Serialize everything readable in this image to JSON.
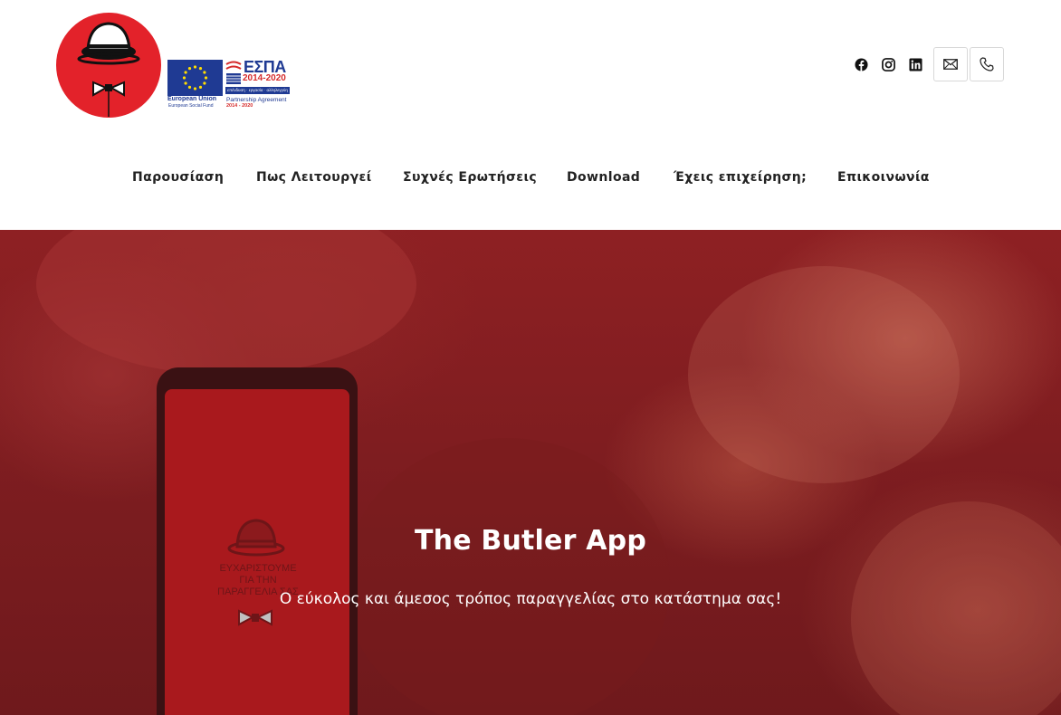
{
  "header": {
    "logo": {
      "icon": "butler-bowler-hat-logo",
      "accent": "#e3222a"
    },
    "sponsors": {
      "eu": {
        "icon": "eu-flag-icon",
        "line1": "European Union",
        "line2": "European Social Fund"
      },
      "espa": {
        "title": "ΕΣΠΑ",
        "years": "2014-2020",
        "bar": "επένδυση · εργασία · αλληλεγγύη",
        "line1": "Partnership Agreement",
        "line2": "2014 - 2020"
      }
    },
    "social": [
      {
        "name": "facebook",
        "icon": "facebook-icon"
      },
      {
        "name": "instagram",
        "icon": "instagram-icon"
      },
      {
        "name": "linkedin",
        "icon": "linkedin-icon"
      }
    ],
    "contact_buttons": [
      {
        "name": "email",
        "icon": "envelope-icon"
      },
      {
        "name": "phone",
        "icon": "phone-icon"
      }
    ]
  },
  "nav": {
    "items": [
      "Παρουσίαση",
      "Πως Λειτουργεί",
      "Συχνές Ερωτήσεις",
      "Download",
      "Έχεις επιχείρηση;",
      "Επικοινωνία"
    ]
  },
  "hero": {
    "title": "The Butler App",
    "subtitle": "Ο εύκολος και άμεσος τρόπος παραγγελίας στο κατάστημα σας!",
    "phone_screen_text": "ΕΥΧΑΡΙΣΤΟΥΜΕ\nΓΙΑ ΤΗΝ\nΠΑΡΑΓΓΕΛΙΑ ΣΑΣ",
    "overlay_color": "#8e2023"
  }
}
